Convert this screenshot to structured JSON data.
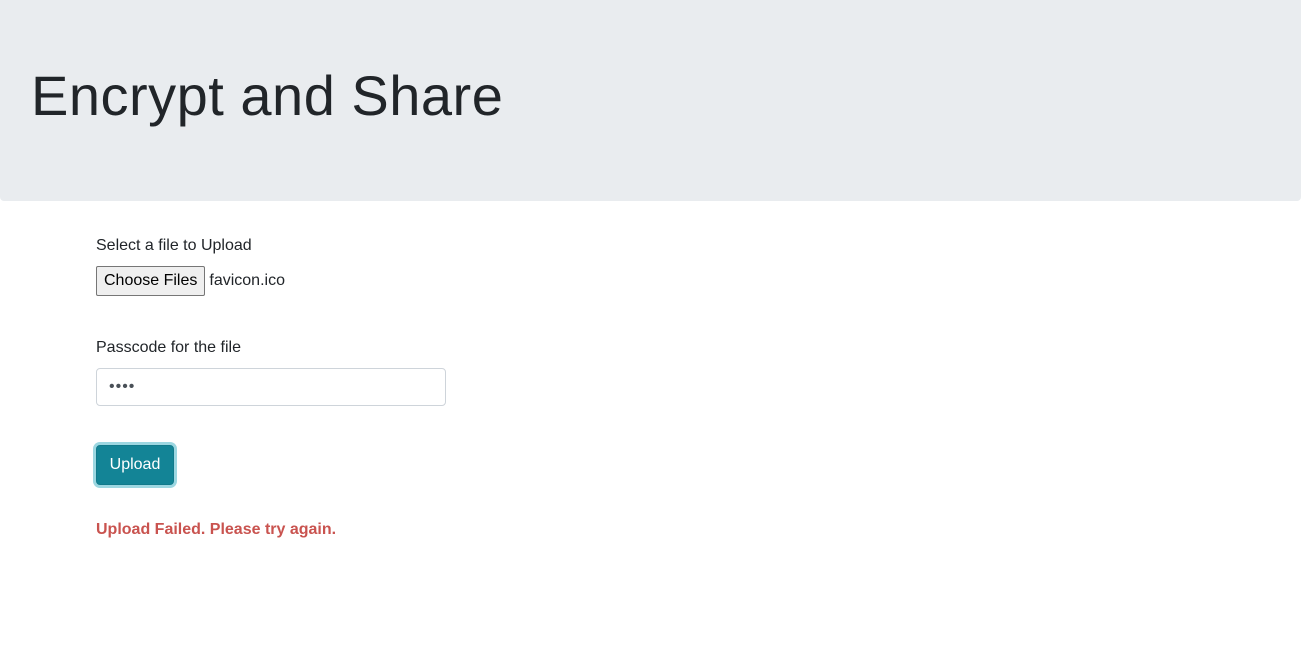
{
  "header": {
    "title": "Encrypt and Share"
  },
  "form": {
    "file_label": "Select a file to Upload",
    "choose_button_label": "Choose Files",
    "selected_file": "favicon.ico",
    "passcode_label": "Passcode for the file",
    "passcode_value_masked": "••••",
    "upload_button_label": "Upload",
    "status_message": "Upload Failed. Please try again."
  },
  "colors": {
    "header_background": "#e9ecef",
    "upload_button": "#138496",
    "error_text": "#c9534f"
  }
}
